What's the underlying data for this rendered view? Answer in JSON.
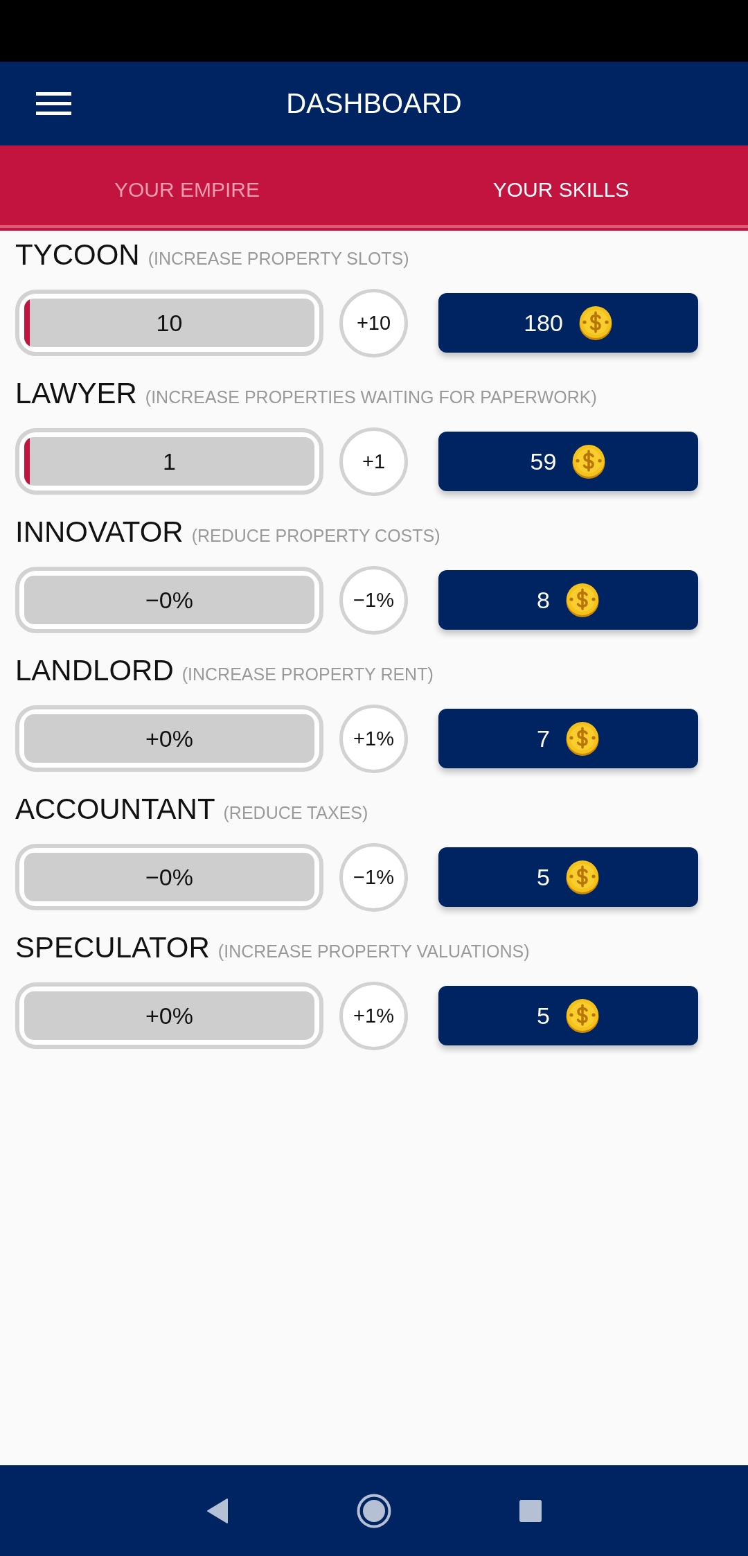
{
  "app_bar": {
    "title": "DASHBOARD"
  },
  "tabs": [
    {
      "label": "YOUR EMPIRE",
      "selected": false
    },
    {
      "label": "YOUR SKILLS",
      "selected": true
    }
  ],
  "skills": [
    {
      "name": "TYCOON",
      "description": "(INCREASE PROPERTY SLOTS)",
      "value": "10",
      "level": 0.02,
      "increment": "+10",
      "cost": "180"
    },
    {
      "name": "LAWYER",
      "description": "(INCREASE PROPERTIES WAITING FOR PAPERWORK)",
      "value": "1",
      "level": 0.02,
      "increment": "+1",
      "cost": "59"
    },
    {
      "name": "INNOVATOR",
      "description": "(REDUCE PROPERTY COSTS)",
      "value": "−0%",
      "level": 0,
      "increment": "−1%",
      "cost": "8"
    },
    {
      "name": "LANDLORD",
      "description": "(INCREASE PROPERTY RENT)",
      "value": "+0%",
      "level": 0,
      "increment": "+1%",
      "cost": "7"
    },
    {
      "name": "ACCOUNTANT",
      "description": "(REDUCE TAXES)",
      "value": "−0%",
      "level": 0,
      "increment": "−1%",
      "cost": "5"
    },
    {
      "name": "SPECULATOR",
      "description": "(INCREASE PROPERTY VALUATIONS)",
      "value": "+0%",
      "level": 0,
      "increment": "+1%",
      "cost": "5"
    }
  ]
}
